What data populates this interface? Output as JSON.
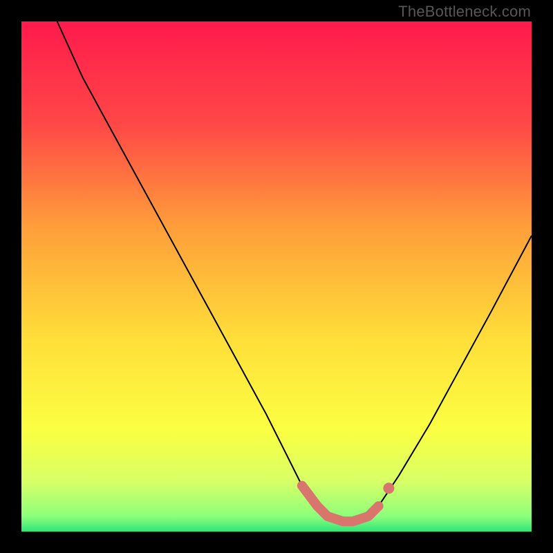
{
  "watermark": "TheBottleneck.com",
  "chart_data": {
    "type": "line",
    "title": "",
    "xlabel": "",
    "ylabel": "",
    "xlim": [
      0,
      100
    ],
    "ylim": [
      0,
      100
    ],
    "grid": false,
    "legend": false,
    "series": [
      {
        "name": "bottleneck-curve",
        "x": [
          7,
          12,
          18,
          24,
          30,
          36,
          42,
          48,
          52,
          55,
          58,
          60,
          63,
          65,
          68,
          70,
          74,
          80,
          86,
          92,
          100
        ],
        "y": [
          100,
          89,
          78,
          67,
          56,
          45,
          34,
          23,
          15,
          9,
          5,
          3,
          2,
          2,
          3,
          5,
          11,
          21,
          32,
          43,
          58
        ]
      }
    ],
    "marker_region": {
      "x": [
        55,
        58,
        60,
        63,
        65,
        68,
        70
      ],
      "y": [
        9,
        5,
        3,
        2,
        2,
        3,
        5
      ],
      "color": "#d8766d"
    },
    "gradient_stops": [
      {
        "offset": 0,
        "color": "#ff1a4c"
      },
      {
        "offset": 20,
        "color": "#ff4747"
      },
      {
        "offset": 40,
        "color": "#ff9d3a"
      },
      {
        "offset": 62,
        "color": "#ffde39"
      },
      {
        "offset": 80,
        "color": "#fbff42"
      },
      {
        "offset": 90,
        "color": "#d9ff66"
      },
      {
        "offset": 97,
        "color": "#8dff7a"
      },
      {
        "offset": 100,
        "color": "#2fe57a"
      }
    ]
  }
}
